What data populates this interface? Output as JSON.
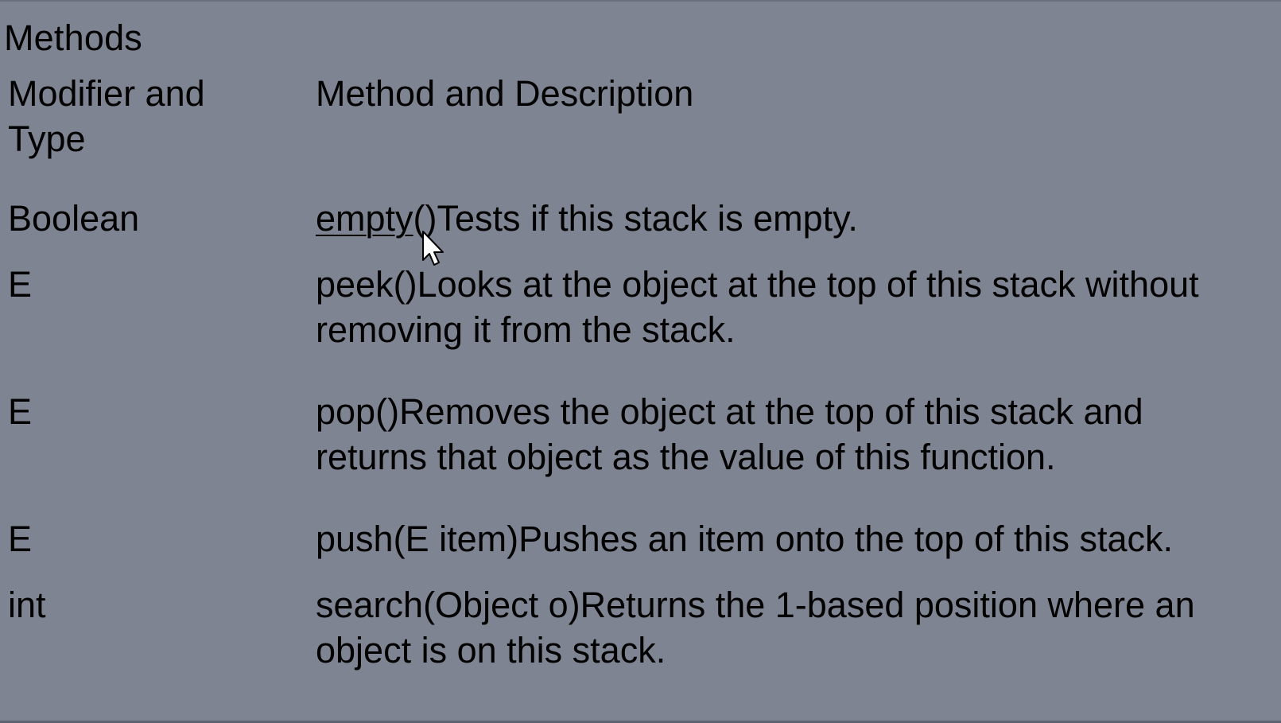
{
  "heading": "Methods",
  "table": {
    "columns": [
      "Modifier and Type",
      "Method and Description"
    ],
    "header_left_lines": [
      "Modifier and",
      "Type"
    ],
    "header_right": "Method and Description",
    "rows": [
      {
        "type": "Boolean",
        "method": "empty",
        "paren": "()",
        "description": "Tests if this stack is empty.",
        "lines": [
          "Tests if this stack is empty."
        ]
      },
      {
        "type": "E",
        "method": "peek()",
        "description": "Looks at the object at the top of this stack without removing it from the stack.",
        "line1_rest": "Looks at the object at the top of this stack without",
        "line2": "removing it from the stack."
      },
      {
        "type": "E",
        "method": "pop()",
        "description": "Removes the object at the top of this stack and returns that object as the value of this function.",
        "line1_rest": "Removes the object at the top of this stack and",
        "line2": "returns that object as the value of this function."
      },
      {
        "type": "E",
        "method": "push(E item)",
        "description": "Pushes an item onto the top of this stack.",
        "line1_rest": "Pushes an item onto the top of this stack."
      },
      {
        "type": "int",
        "method": "search(Object o)",
        "description": "Returns the 1-based position where an object is on this stack.",
        "line1_rest": "Returns the 1-based position where an",
        "line2": "object is on this stack."
      }
    ]
  },
  "icons": {
    "cursor": "mouse-pointer-icon"
  },
  "colors": {
    "background": "#7e8491",
    "text": "#000000"
  }
}
